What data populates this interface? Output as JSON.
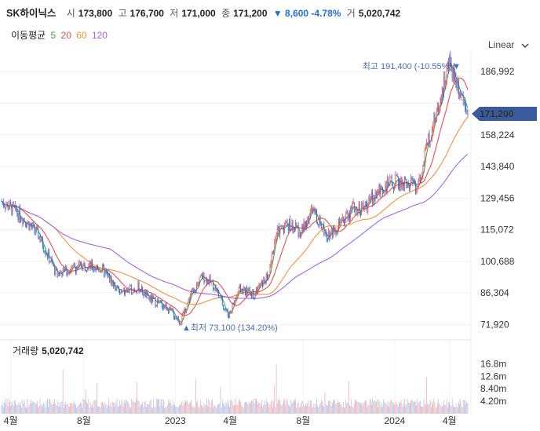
{
  "header": {
    "name": "SK하이닉스",
    "open_label": "시",
    "open": "173,800",
    "high_label": "고",
    "high": "176,700",
    "low_label": "저",
    "low": "171,000",
    "close_label": "종",
    "close": "171,200",
    "change": "▼ 8,600 -4.78%",
    "volume_label": "거",
    "volume": "5,020,742"
  },
  "ma_legend": {
    "label": "이동평균",
    "periods": [
      {
        "text": "5",
        "color": "#3da73d"
      },
      {
        "text": "20",
        "color": "#e05050"
      },
      {
        "text": "60",
        "color": "#f0933c"
      },
      {
        "text": "120",
        "color": "#a066e6"
      }
    ]
  },
  "scale_toggle": {
    "label": "Linear",
    "icon": "chevron-down-icon"
  },
  "colors": {
    "up": "#e8505b",
    "down": "#1e6fd9",
    "current_badge": "#3a5a9e",
    "annotation": "#4a6db5",
    "ma5": "#3da73d",
    "ma20": "#e05050",
    "ma60": "#f0933c",
    "ma120": "#a066e6"
  },
  "annotations": {
    "max_label": "최고 191,400 (-10.55%)▼",
    "min_label": "▲최저 73,100 (134.20%)"
  },
  "current_price_badge": "171,200",
  "volume_panel": {
    "label": "거래량",
    "value": "5,020,742"
  },
  "chart_data": {
    "type": "candlestick",
    "title": "SK하이닉스",
    "price_axis": {
      "ticks": [
        186992,
        172608,
        158224,
        143840,
        129456,
        115072,
        100688,
        86304,
        71920
      ],
      "tick_labels": [
        "186,992",
        "",
        "158,224",
        "143,840",
        "129,456",
        "115,072",
        "100,688",
        "86,304",
        "71,920"
      ],
      "ylim": [
        66000,
        196000
      ]
    },
    "volume_axis": {
      "tick_labels": [
        "16.8m",
        "12.6m",
        "8.40m",
        "4.20m"
      ],
      "ticks": [
        16.8,
        12.6,
        8.4,
        4.2
      ],
      "unit": "m"
    },
    "x_axis": {
      "labels": [
        "4월",
        "8월",
        "2023",
        "4월",
        "8월",
        "2024",
        "4월"
      ]
    },
    "x_range_months": 25.5,
    "price_monthly": {
      "months": [
        "2022-03",
        "2022-04",
        "2022-05",
        "2022-06",
        "2022-07",
        "2022-08",
        "2022-09",
        "2022-10",
        "2022-11",
        "2022-12",
        "2023-01",
        "2023-02",
        "2023-03",
        "2023-04",
        "2023-05",
        "2023-06",
        "2023-07",
        "2023-08",
        "2023-09",
        "2023-10",
        "2023-11",
        "2023-12",
        "2024-01",
        "2024-02",
        "2024-03",
        "2024-04"
      ],
      "close": [
        126000,
        120000,
        111000,
        94000,
        100000,
        96000,
        86000,
        84000,
        81000,
        76000,
        89000,
        91000,
        86000,
        85000,
        96000,
        115000,
        118000,
        116000,
        121000,
        124000,
        127000,
        135000,
        139000,
        145000,
        168000,
        171200
      ]
    },
    "price_points": [
      [
        0.0,
        128000
      ],
      [
        1.0,
        122000
      ],
      [
        2.0,
        113000
      ],
      [
        3.0,
        95000
      ],
      [
        4.5,
        99000
      ],
      [
        5.5,
        97000
      ],
      [
        6.5,
        86000
      ],
      [
        7.5,
        89000
      ],
      [
        8.0,
        84000
      ],
      [
        9.0,
        80000
      ],
      [
        9.8,
        73100
      ],
      [
        10.3,
        85000
      ],
      [
        11.0,
        94000
      ],
      [
        11.6,
        90000
      ],
      [
        12.4,
        76000
      ],
      [
        13.0,
        88000
      ],
      [
        13.8,
        86000
      ],
      [
        14.6,
        94000
      ],
      [
        15.0,
        113000
      ],
      [
        15.6,
        118000
      ],
      [
        16.4,
        114000
      ],
      [
        17.0,
        124000
      ],
      [
        17.8,
        113000
      ],
      [
        18.6,
        118000
      ],
      [
        19.2,
        125000
      ],
      [
        19.8,
        125000
      ],
      [
        20.8,
        134000
      ],
      [
        21.6,
        137000
      ],
      [
        22.0,
        136000
      ],
      [
        22.8,
        135000
      ],
      [
        23.4,
        158000
      ],
      [
        23.8,
        168000
      ],
      [
        24.5,
        191400
      ],
      [
        25.2,
        176000
      ],
      [
        25.5,
        171200
      ]
    ],
    "moving_averages": [
      {
        "period": 5,
        "color": "#3da73d"
      },
      {
        "period": 20,
        "color": "#e05050"
      },
      {
        "period": 60,
        "color": "#f0933c"
      },
      {
        "period": 120,
        "color": "#a066e6"
      }
    ],
    "max": {
      "value": 191400,
      "change_pct": -10.55
    },
    "min": {
      "value": 73100,
      "change_pct": 134.2
    },
    "last": {
      "open": 173800,
      "high": 176700,
      "low": 171000,
      "close": 171200,
      "volume": 5020742
    }
  }
}
